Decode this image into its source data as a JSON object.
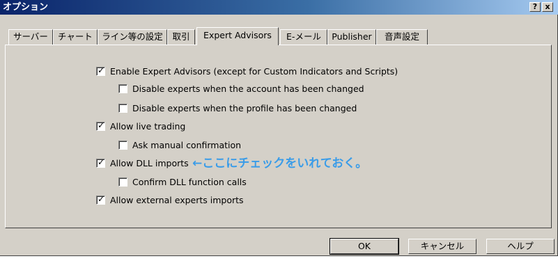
{
  "window": {
    "title": "オプション"
  },
  "titlebar_buttons": {
    "help": "?",
    "close": "x"
  },
  "tabs": [
    {
      "label": "サーバー",
      "active": false
    },
    {
      "label": "チャート",
      "active": false
    },
    {
      "label": "ライン等の設定",
      "active": false
    },
    {
      "label": "取引",
      "active": false
    },
    {
      "label": "Expert Advisors",
      "active": true
    },
    {
      "label": "E-メール",
      "active": false
    },
    {
      "label": "Publisher",
      "active": false
    },
    {
      "label": "音声設定",
      "active": false
    }
  ],
  "options": [
    {
      "label": "Enable Expert Advisors (except for Custom Indicators and Scripts)",
      "checked": true
    },
    {
      "label": "Disable experts when the account has been changed",
      "checked": false
    },
    {
      "label": "Disable experts when the profile has been changed",
      "checked": false
    },
    {
      "label": "Allow live trading",
      "checked": true
    },
    {
      "label": "Ask manual confirmation",
      "checked": false
    },
    {
      "label": "Allow DLL imports",
      "checked": true
    },
    {
      "label": "Confirm DLL function calls",
      "checked": false
    },
    {
      "label": "Allow external experts imports",
      "checked": true
    }
  ],
  "annotation": "←ここにチェックをいれておく。",
  "buttons": {
    "ok": "OK",
    "cancel": "キャンセル",
    "help": "ヘルプ"
  }
}
